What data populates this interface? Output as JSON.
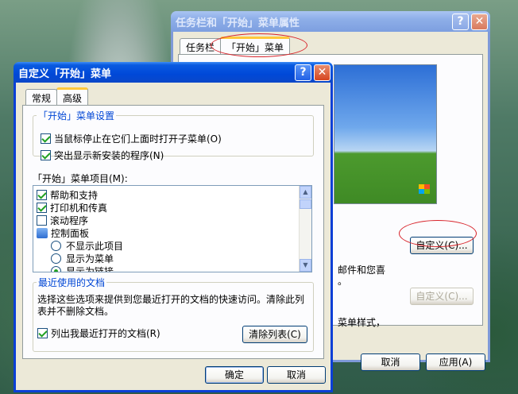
{
  "back_window": {
    "title": "任务栏和「开始」菜单属性",
    "help_button": "?",
    "close_button": "✕",
    "tabs": [
      "任务栏",
      "「开始」菜单"
    ],
    "customize_button": "自定义(C)...",
    "customize_disabled_button": "自定义(C)...",
    "partial_text_1": "邮件和您喜",
    "partial_text_2": "。",
    "partial_text_3": "菜单样式，",
    "cancel_button": "取消",
    "apply_button": "应用(A)"
  },
  "front_window": {
    "title": "自定义「开始」菜单",
    "help_button": "?",
    "close_button": "✕",
    "tabs": [
      "常规",
      "高级"
    ],
    "settings_group": {
      "legend": "「开始」菜单设置",
      "options": [
        {
          "label": "当鼠标停止在它们上面时打开子菜单(O)",
          "checked": true
        },
        {
          "label": "突出显示新安装的程序(N)",
          "checked": true
        }
      ]
    },
    "items_label": "「开始」菜单项目(M):",
    "items": [
      {
        "type": "check",
        "label": "帮助和支持",
        "checked": true
      },
      {
        "type": "check",
        "label": "打印机和传真",
        "checked": true
      },
      {
        "type": "check",
        "label": "滚动程序",
        "checked": false
      },
      {
        "type": "folder",
        "label": "控制面板"
      },
      {
        "type": "radio",
        "label": "不显示此项目",
        "checked": false
      },
      {
        "type": "radio",
        "label": "显示为菜单",
        "checked": false
      },
      {
        "type": "radio",
        "label": "显示为链接",
        "checked": true
      }
    ],
    "recent_group": {
      "legend": "最近使用的文档",
      "description": "选择这些选项来提供到您最近打开的文档的快速访问。清除此列表并不删除文档。",
      "list_recent_label": "列出我最近打开的文档(R)",
      "list_recent_checked": true,
      "clear_button": "清除列表(C)"
    },
    "ok_button": "确定",
    "cancel_button": "取消"
  }
}
